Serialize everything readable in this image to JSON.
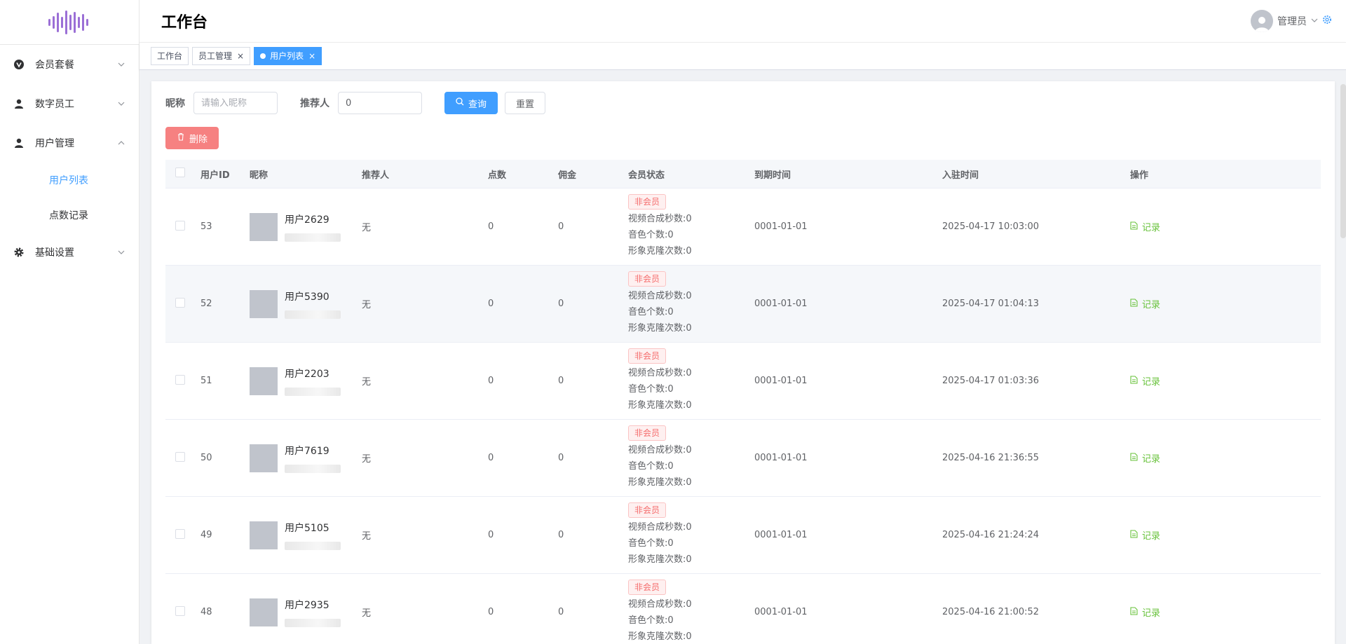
{
  "header": {
    "title": "工作台",
    "user_name": "管理员"
  },
  "sidebar": {
    "items": [
      {
        "label": "会员套餐",
        "icon": "vip-badge-icon",
        "expanded": false
      },
      {
        "label": "数字员工",
        "icon": "person-icon",
        "expanded": false
      },
      {
        "label": "用户管理",
        "icon": "person-icon",
        "expanded": true,
        "children": [
          {
            "label": "用户列表",
            "active": true
          },
          {
            "label": "点数记录",
            "active": false
          }
        ]
      },
      {
        "label": "基础设置",
        "icon": "gear-icon",
        "expanded": false
      }
    ]
  },
  "tags": [
    {
      "label": "工作台",
      "active": false,
      "closable": false
    },
    {
      "label": "员工管理",
      "active": false,
      "closable": true
    },
    {
      "label": "用户列表",
      "active": true,
      "closable": true
    }
  ],
  "search": {
    "nickname_label": "昵称",
    "nickname_placeholder": "请输入昵称",
    "referrer_label": "推荐人",
    "referrer_value": "0",
    "query_label": "查询",
    "reset_label": "重置"
  },
  "toolbar": {
    "delete_label": "删除"
  },
  "table": {
    "columns": [
      "用户ID",
      "昵称",
      "推荐人",
      "点数",
      "佣金",
      "会员状态",
      "到期时间",
      "入驻时间",
      "操作"
    ],
    "rows": [
      {
        "id": "53",
        "nickname": "用户2629",
        "referrer": "无",
        "points": "0",
        "commission": "0",
        "vip_status": "非会员",
        "video_sec": "视频合成秒数:0",
        "voice_count": "音色个数:0",
        "avatar_clone": "形象克隆次数:0",
        "expire": "0001-01-01",
        "joined": "2025-04-17 10:03:00",
        "op": "记录"
      },
      {
        "id": "52",
        "nickname": "用户5390",
        "referrer": "无",
        "points": "0",
        "commission": "0",
        "vip_status": "非会员",
        "video_sec": "视频合成秒数:0",
        "voice_count": "音色个数:0",
        "avatar_clone": "形象克隆次数:0",
        "expire": "0001-01-01",
        "joined": "2025-04-17 01:04:13",
        "op": "记录"
      },
      {
        "id": "51",
        "nickname": "用户2203",
        "referrer": "无",
        "points": "0",
        "commission": "0",
        "vip_status": "非会员",
        "video_sec": "视频合成秒数:0",
        "voice_count": "音色个数:0",
        "avatar_clone": "形象克隆次数:0",
        "expire": "0001-01-01",
        "joined": "2025-04-17 01:03:36",
        "op": "记录"
      },
      {
        "id": "50",
        "nickname": "用户7619",
        "referrer": "无",
        "points": "0",
        "commission": "0",
        "vip_status": "非会员",
        "video_sec": "视频合成秒数:0",
        "voice_count": "音色个数:0",
        "avatar_clone": "形象克隆次数:0",
        "expire": "0001-01-01",
        "joined": "2025-04-16 21:36:55",
        "op": "记录"
      },
      {
        "id": "49",
        "nickname": "用户5105",
        "referrer": "无",
        "points": "0",
        "commission": "0",
        "vip_status": "非会员",
        "video_sec": "视频合成秒数:0",
        "voice_count": "音色个数:0",
        "avatar_clone": "形象克隆次数:0",
        "expire": "0001-01-01",
        "joined": "2025-04-16 21:24:24",
        "op": "记录"
      },
      {
        "id": "48",
        "nickname": "用户2935",
        "referrer": "无",
        "points": "0",
        "commission": "0",
        "vip_status": "非会员",
        "video_sec": "视频合成秒数:0",
        "voice_count": "音色个数:0",
        "avatar_clone": "形象克隆次数:0",
        "expire": "0001-01-01",
        "joined": "2025-04-16 21:00:52",
        "op": "记录"
      }
    ]
  },
  "colors": {
    "primary": "#409eff",
    "danger": "#f56c6c",
    "success": "#67c23a",
    "logo": "#9b5de5"
  }
}
